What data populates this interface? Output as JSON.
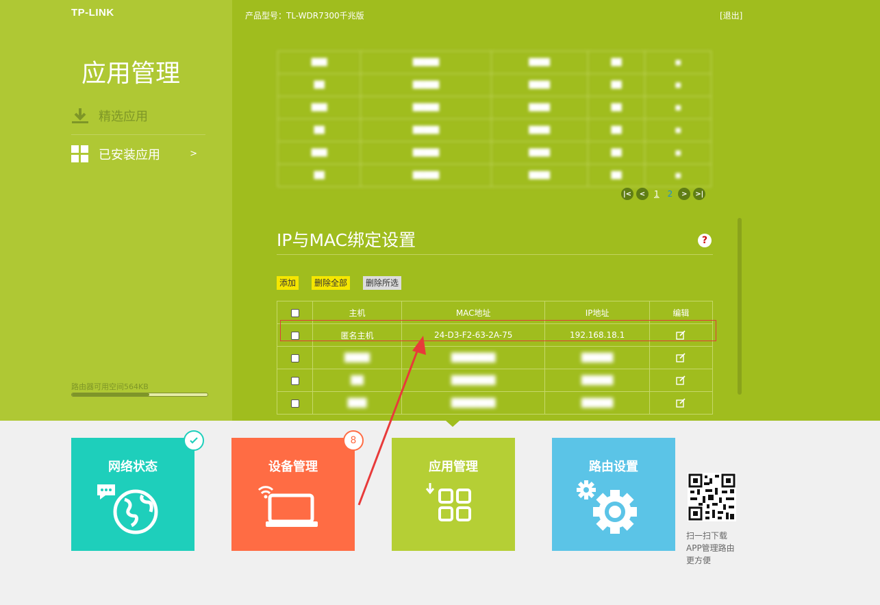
{
  "header": {
    "logo": "TP-LINK",
    "model": "产品型号：TL-WDR7300千兆版",
    "logout": "[退出]"
  },
  "sidebar": {
    "title": "应用管理",
    "items": [
      {
        "label": "精选应用",
        "icon": "download-icon"
      },
      {
        "label": "已安装应用",
        "icon": "grid-icon",
        "arrow": ">"
      }
    ],
    "storage_label": "路由器可用空间564KB",
    "storage_used_fraction": 0.57
  },
  "pagination": {
    "pages": [
      "1",
      "2"
    ],
    "current": "2"
  },
  "binding": {
    "title": "IP与MAC绑定设置",
    "help": "?",
    "buttons": {
      "add": "添加",
      "delete_all": "删除全部",
      "delete_selected": "删除所选"
    },
    "columns": [
      "主机",
      "MAC地址",
      "IP地址",
      "编辑"
    ],
    "rows": [
      {
        "host": "匿名主机",
        "mac": "24-D3-F2-63-2A-75",
        "ip": "192.168.18.1"
      }
    ]
  },
  "tiles": [
    {
      "label": "网络状态",
      "icon": "globe-chat-icon"
    },
    {
      "label": "设备管理",
      "icon": "laptop-wifi-icon",
      "badge": "8"
    },
    {
      "label": "应用管理",
      "icon": "apps-grid-icon"
    },
    {
      "label": "路由设置",
      "icon": "gears-icon"
    }
  ],
  "qr": {
    "lines": [
      "扫一扫下载",
      "APP管理路由",
      "更方便"
    ]
  },
  "colors": {
    "sidebar_bg": "#afc834",
    "content_bg": "#a0bd1e",
    "tile_network": "#1ecfbb",
    "tile_device": "#ff6c44",
    "tile_app": "#b5cf35",
    "tile_route": "#5bc4e7",
    "highlight": "#e03a3a"
  }
}
